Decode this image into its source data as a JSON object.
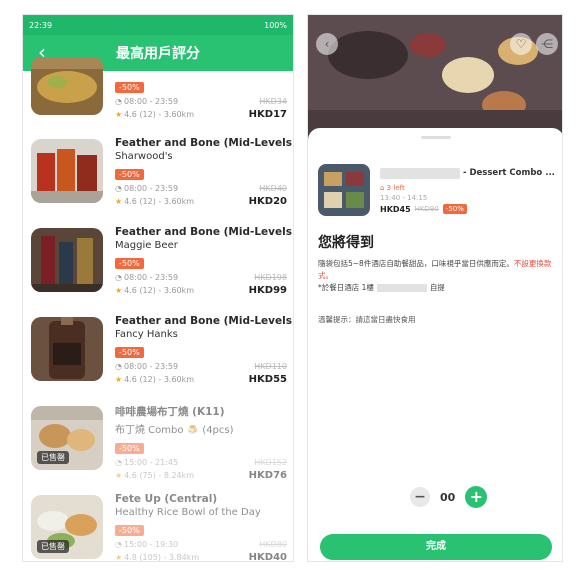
{
  "left": {
    "status_bar": {
      "time": "22:39",
      "battery": "100%"
    },
    "header": {
      "title": "最高用戶評分",
      "back_icon": "chevron-left-icon"
    },
    "items": [
      {
        "store": "",
        "sub": "",
        "discount": "-50%",
        "time": "08:00 - 23:59",
        "rating": "4.6 (12) - 3.60km",
        "orig_price": "HKD34",
        "price": "HKD17",
        "badge": "",
        "faded": false
      },
      {
        "store": "Feather and Bone (Mid-Levels)",
        "sub": "Sharwood's",
        "discount": "-50%",
        "time": "08:00 - 23:59",
        "rating": "4.6 (12) - 3.60km",
        "orig_price": "HKD40",
        "price": "HKD20",
        "badge": "",
        "faded": false
      },
      {
        "store": "Feather and Bone (Mid-Levels)",
        "sub": "Maggie Beer",
        "discount": "-50%",
        "time": "08:00 - 23:59",
        "rating": "4.6 (12) - 3.60km",
        "orig_price": "HKD198",
        "price": "HKD99",
        "badge": "",
        "faded": false
      },
      {
        "store": "Feather and Bone (Mid-Levels)",
        "sub": "Fancy Hanks",
        "discount": "-50%",
        "time": "08:00 - 23:59",
        "rating": "4.6 (12) - 3.60km",
        "orig_price": "HKD110",
        "price": "HKD55",
        "badge": "",
        "faded": false
      },
      {
        "store": "啡啡農場布丁燒 (K11)",
        "sub": "布丁燒 Combo 🍮 (4pcs)",
        "discount": "-50%",
        "time": "15:00 - 21:45",
        "rating": "4.6 (75) - 8.24km",
        "orig_price": "HKD152",
        "price": "HKD76",
        "badge": "已售罄",
        "faded": true
      },
      {
        "store": "Fete Up (Central)",
        "sub": "Healthy Rice Bowl of the Day",
        "discount": "-50%",
        "time": "15:00 - 19:30",
        "rating": "4.8 (105) - 3.84km",
        "orig_price": "HKD80",
        "price": "HKD40",
        "badge": "已售罄",
        "faded": true
      }
    ]
  },
  "right": {
    "icons": {
      "back": "back-icon",
      "heart": "heart-icon",
      "share": "share-icon"
    },
    "product": {
      "name_suffix": "- Dessert Combo ...",
      "left_count": "3 left",
      "time": "13:40 - 14:15",
      "price": "HKD45",
      "orig_price": "HKD90",
      "discount": "-50%"
    },
    "get_title": "您將得到",
    "desc_line1": "隨袋包括5~8件酒店自助餐甜品，口味視乎當日供應而定。",
    "desc_red": "不設更換款式。",
    "desc_line2_prefix": "*於餐日酒店 1樓",
    "desc_line2_suffix": "自提",
    "tip": "溫馨提示：請這當日盡快食用",
    "quantity": "00",
    "done_label": "完成"
  },
  "colors": {
    "brand_green": "#29c172",
    "discount_orange": "#f2693e",
    "star": "#f5a623"
  }
}
